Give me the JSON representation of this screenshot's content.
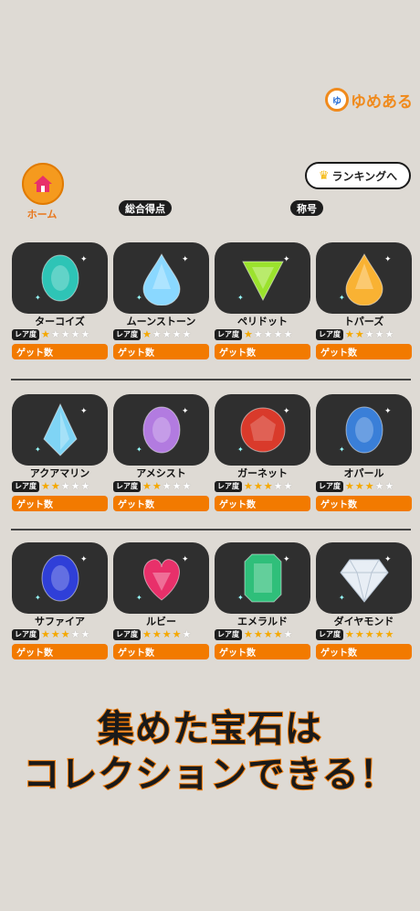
{
  "logo": {
    "text": "ゆめある",
    "face": "ゆ"
  },
  "home": {
    "label": "ホーム"
  },
  "ranking": {
    "label": "ランキングへ"
  },
  "headers": {
    "total_score": "総合得点",
    "title": "称号"
  },
  "rarity_label": "レア度",
  "get_label": "ゲット数",
  "gems": [
    {
      "name": "ターコイズ",
      "rarity": 1,
      "shape": "oval",
      "color": "#2ec4b6"
    },
    {
      "name": "ムーンストーン",
      "rarity": 1,
      "shape": "drop",
      "color": "#8ad8ff"
    },
    {
      "name": "ペリドット",
      "rarity": 1,
      "shape": "triangle",
      "color": "#9be22d"
    },
    {
      "name": "トパーズ",
      "rarity": 2,
      "shape": "drop",
      "color": "#f9b233"
    },
    {
      "name": "アクアマリン",
      "rarity": 2,
      "shape": "kite",
      "color": "#7fd4f5"
    },
    {
      "name": "アメシスト",
      "rarity": 2,
      "shape": "oval",
      "color": "#b27be0"
    },
    {
      "name": "ガーネット",
      "rarity": 3,
      "shape": "round",
      "color": "#d93a2b"
    },
    {
      "name": "オパール",
      "rarity": 3,
      "shape": "oval",
      "color": "#3a7fd8"
    },
    {
      "name": "サファイア",
      "rarity": 3,
      "shape": "oval",
      "color": "#2f3fd8"
    },
    {
      "name": "ルビー",
      "rarity": 4,
      "shape": "heart",
      "color": "#e8306a"
    },
    {
      "name": "エメラルド",
      "rarity": 4,
      "shape": "emerald",
      "color": "#2fbf7a"
    },
    {
      "name": "ダイヤモンド",
      "rarity": 5,
      "shape": "diamond",
      "color": "#e8eef5"
    }
  ],
  "promo": {
    "line1": "集めた宝石は",
    "line2": "コレクションできる！"
  }
}
